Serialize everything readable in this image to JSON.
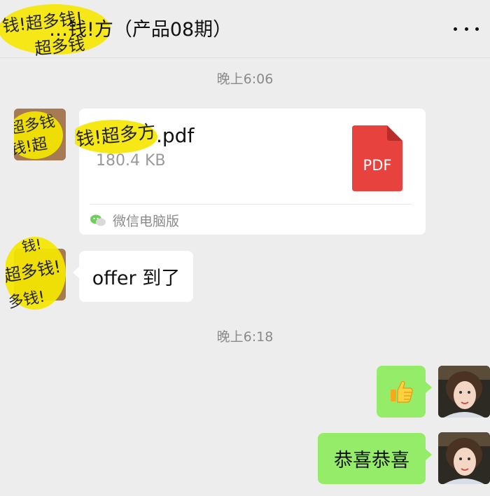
{
  "header": {
    "title": "…钱!方（产品08期）",
    "more_icon": "more-dots-icon"
  },
  "messages": {
    "timestamp_1": "晚上6:06",
    "file": {
      "name": ".pdf",
      "size": "180.4 KB",
      "type_label": "PDF",
      "source_label": "微信电脑版",
      "source_icon": "wechat-icon"
    },
    "offer_text": "offer 到了",
    "timestamp_2": "晚上6:18",
    "thumbs_up_icon": "thumbs-up-emoji-icon",
    "congrats_text": "恭喜恭喜"
  },
  "colors": {
    "background": "#ededed",
    "bubble_self": "#95ec69",
    "bubble_other": "#ffffff",
    "pdf_red": "#e8423e",
    "scribble_yellow": "#f5e600"
  }
}
